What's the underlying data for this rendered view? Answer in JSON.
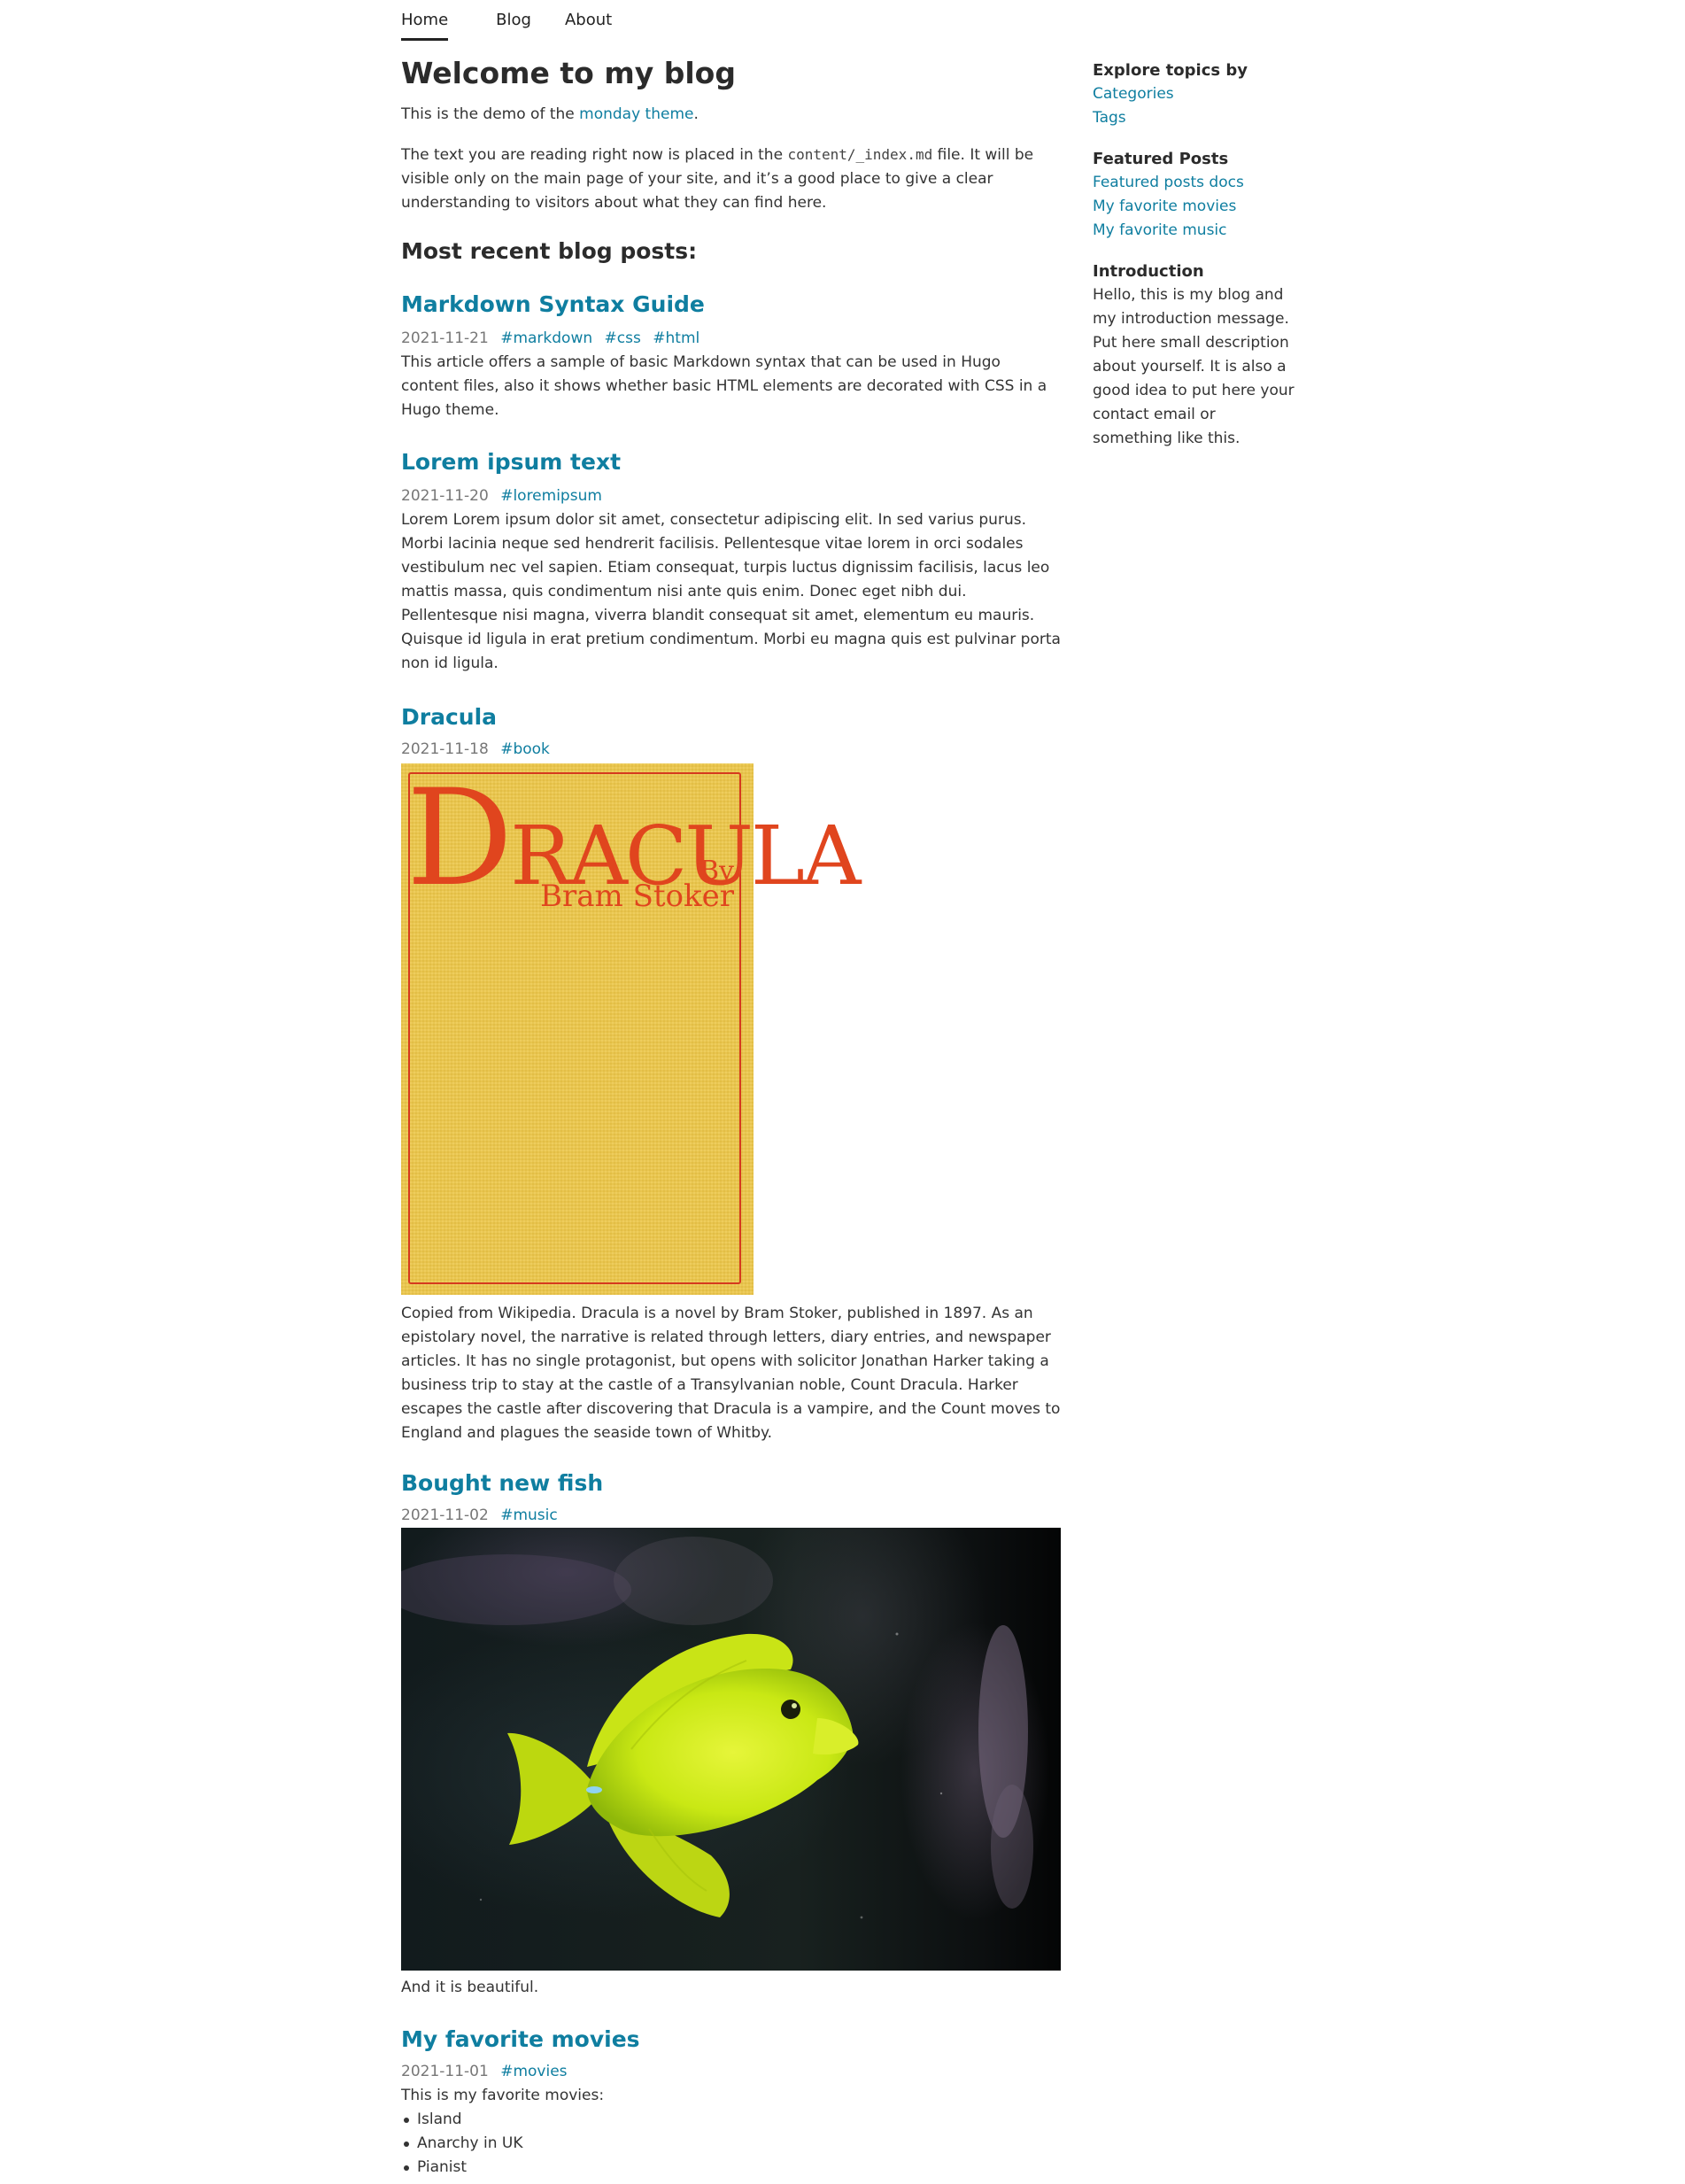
{
  "nav": {
    "items": [
      {
        "label": "Home",
        "active": true
      },
      {
        "label": "Blog",
        "active": false
      },
      {
        "label": "About",
        "active": false
      }
    ]
  },
  "main": {
    "title": "Welcome to my blog",
    "intro_prefix": "This is the demo of the ",
    "intro_link": "monday theme",
    "intro_suffix": ".",
    "explain_prefix": "The text you are reading right now is placed in the ",
    "explain_code": "content/_index.md",
    "explain_suffix": " file. It will be visible only on the main page of your site, and it’s a good place to give a clear understanding to visitors about what they can find here.",
    "recent_heading": "Most recent blog posts:"
  },
  "posts": [
    {
      "title": "Markdown Syntax Guide",
      "date": "2021-11-21",
      "tags": [
        "#markdown",
        "#css",
        "#html"
      ],
      "summary": "This article offers a sample of basic Markdown syntax that can be used in Hugo content files, also it shows whether basic HTML elements are decorated with CSS in a Hugo theme."
    },
    {
      "title": "Lorem ipsum text",
      "date": "2021-11-20",
      "tags": [
        "#loremipsum"
      ],
      "summary": "Lorem Lorem ipsum dolor sit amet, consectetur adipiscing elit. In sed varius purus. Morbi lacinia neque sed hendrerit facilisis. Pellentesque vitae lorem in orci sodales vestibulum nec vel sapien. Etiam consequat, turpis luctus dignissim facilisis, lacus leo mattis massa, quis condimentum nisi ante quis enim. Donec eget nibh dui. Pellentesque nisi magna, viverra blandit consequat sit amet, elementum eu mauris. Quisque id ligula in erat pretium condimentum. Morbi eu magna quis est pulvinar porta non id ligula."
    },
    {
      "title": "Dracula",
      "date": "2021-11-18",
      "tags": [
        "#book"
      ],
      "image": {
        "cover_title_initial": "D",
        "cover_title_rest": "RACULA",
        "cover_by": "By",
        "cover_author": "Bram Stoker",
        "colors": {
          "background": "#ecc84d",
          "lettering": "#e0451e"
        }
      },
      "summary": "Copied from Wikipedia. Dracula is a novel by Bram Stoker, published in 1897. As an epistolary novel, the narrative is related through letters, diary entries, and newspaper articles. It has no single protagonist, but opens with solicitor Jonathan Harker taking a business trip to stay at the castle of a Transylvanian noble, Count Dracula. Harker escapes the castle after discovering that Dracula is a vampire, and the Count moves to England and plagues the seaside town of Whitby."
    },
    {
      "title": "Bought new fish",
      "date": "2021-11-02",
      "tags": [
        "#music"
      ],
      "image": {
        "subject": "yellow tang fish in an aquarium"
      },
      "summary": "And it is beautiful."
    },
    {
      "title": "My favorite movies",
      "date": "2021-11-01",
      "tags": [
        "#movies"
      ],
      "summary": "This is my favorite movies:",
      "list": [
        "Island",
        "Anarchy in UK",
        "Pianist"
      ]
    }
  ],
  "sidebar": {
    "topics": {
      "heading": "Explore topics by",
      "links": [
        "Categories",
        "Tags"
      ]
    },
    "featured": {
      "heading": "Featured Posts",
      "links": [
        "Featured posts docs",
        "My favorite movies",
        "My favorite music"
      ]
    },
    "introduction": {
      "heading": "Introduction",
      "text": "Hello, this is my blog and my introduction message. Put here small description about yourself. It is also a good idea to put here your contact email or something like this."
    }
  },
  "colors": {
    "link": "#0f7ea0",
    "text": "#333333",
    "date": "#777777"
  }
}
